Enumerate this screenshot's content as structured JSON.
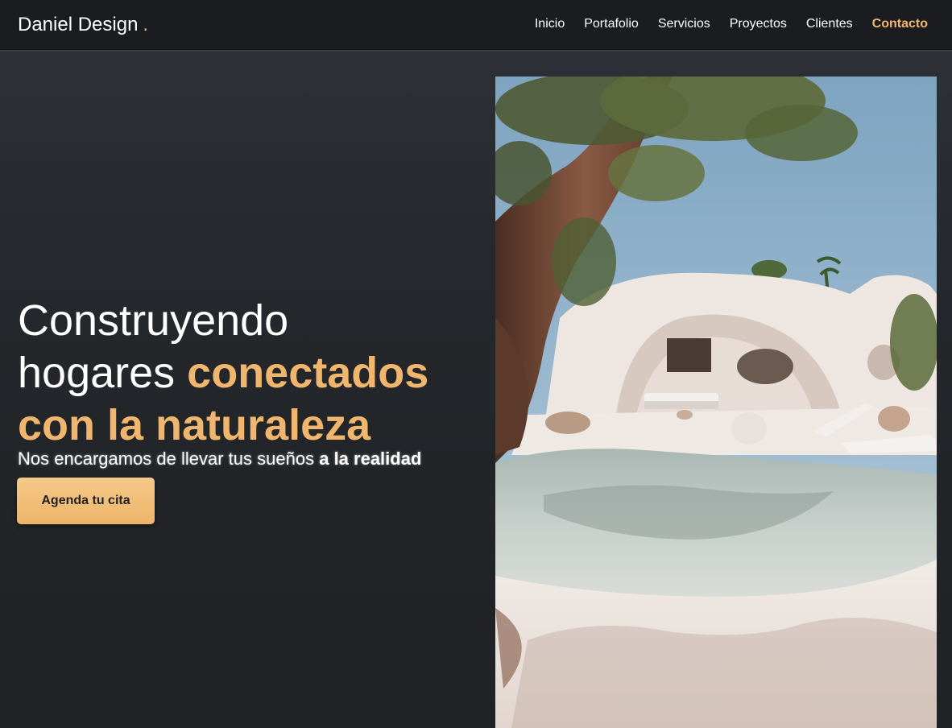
{
  "brand": {
    "name": "Daniel Design",
    "dot": "."
  },
  "nav": {
    "items": [
      {
        "label": "Inicio"
      },
      {
        "label": "Portafolio"
      },
      {
        "label": "Servicios"
      },
      {
        "label": "Proyectos"
      },
      {
        "label": "Clientes"
      },
      {
        "label": "Contacto",
        "active": true
      }
    ]
  },
  "hero": {
    "headline_line1": "Construyendo",
    "headline_line2_plain": "hogares",
    "headline_line2_accent": "conectados",
    "headline_line3_accent": "con la naturaleza",
    "subtitle_plain": "Nos encargamos de llevar tus sueños",
    "subtitle_bold": "a la realidad",
    "cta_label": "Agenda tu cita"
  },
  "colors": {
    "accent": "#f0b66e",
    "background": "#202225",
    "topbar": "#1b1c1f"
  }
}
